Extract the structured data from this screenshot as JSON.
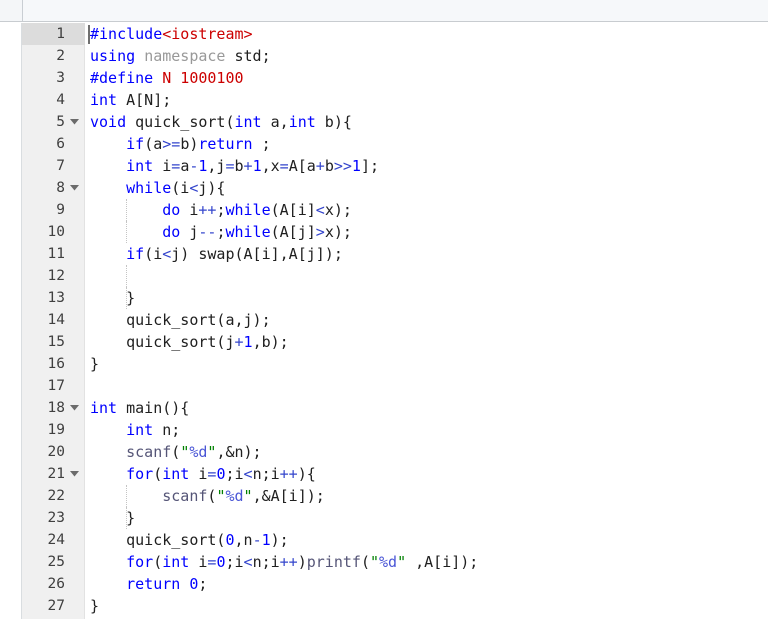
{
  "window": {
    "title": "",
    "toolbar_label": ""
  },
  "editor": {
    "language": "C++",
    "current_line": 1,
    "total_lines_visible": 27,
    "colors": {
      "background": "#ffffff",
      "gutter_background": "#f0f0f0",
      "current_line_gutter": "#dcdcdc",
      "keyword": "#0000ff",
      "string": "#008000",
      "macro": "#cc0000",
      "namespace_gray": "#999999",
      "operator": "#3344cc",
      "format_spec": "#4a56d6",
      "text": "#202020",
      "toolbar": "#f6f8fa"
    },
    "lines": [
      {
        "n": "1",
        "fold": false,
        "guides": []
      },
      {
        "n": "2",
        "fold": false,
        "guides": []
      },
      {
        "n": "3",
        "fold": false,
        "guides": []
      },
      {
        "n": "4",
        "fold": false,
        "guides": []
      },
      {
        "n": "5",
        "fold": true,
        "guides": []
      },
      {
        "n": "6",
        "fold": false,
        "guides": []
      },
      {
        "n": "7",
        "fold": false,
        "guides": []
      },
      {
        "n": "8",
        "fold": true,
        "guides": []
      },
      {
        "n": "9",
        "fold": false,
        "guides": [
          126
        ]
      },
      {
        "n": "10",
        "fold": false,
        "guides": [
          126
        ]
      },
      {
        "n": "11",
        "fold": false,
        "guides": []
      },
      {
        "n": "12",
        "fold": false,
        "guides": [
          126
        ]
      },
      {
        "n": "13",
        "fold": false,
        "guides": [
          126
        ]
      },
      {
        "n": "14",
        "fold": false,
        "guides": []
      },
      {
        "n": "15",
        "fold": false,
        "guides": []
      },
      {
        "n": "16",
        "fold": false,
        "guides": []
      },
      {
        "n": "17",
        "fold": false,
        "guides": []
      },
      {
        "n": "18",
        "fold": true,
        "guides": []
      },
      {
        "n": "19",
        "fold": false,
        "guides": []
      },
      {
        "n": "20",
        "fold": false,
        "guides": []
      },
      {
        "n": "21",
        "fold": true,
        "guides": []
      },
      {
        "n": "22",
        "fold": false,
        "guides": [
          126
        ]
      },
      {
        "n": "23",
        "fold": false,
        "guides": [
          126
        ]
      },
      {
        "n": "24",
        "fold": false,
        "guides": []
      },
      {
        "n": "25",
        "fold": false,
        "guides": []
      },
      {
        "n": "26",
        "fold": false,
        "guides": []
      },
      {
        "n": "27",
        "fold": false,
        "guides": []
      }
    ],
    "source_text": [
      "#include<iostream>",
      "using namespace std;",
      "#define N 1000100",
      "int A[N];",
      "void quick_sort(int a,int b){",
      "    if(a>=b)return ;",
      "    int i=a-1,j=b+1,x=A[a+b>>1];",
      "    while(i<j){",
      "        do i++;while(A[i]<x);",
      "        do j--;while(A[j]>x);",
      "    if(i<j) swap(A[i],A[j]);",
      "",
      "    }",
      "    quick_sort(a,j);",
      "    quick_sort(j+1,b);",
      "}",
      "",
      "int main(){",
      "    int n;",
      "    scanf(\"%d\",&n);",
      "    for(int i=0;i<n;i++){",
      "        scanf(\"%d\",&A[i]);",
      "    }",
      "    quick_sort(0,n-1);",
      "    for(int i=0;i<n;i++)printf(\"%d \",A[i]);",
      "    return 0;",
      "}"
    ],
    "tokens": [
      [
        {
          "t": "#include",
          "c": "t-pre"
        },
        {
          "t": "<iostream>",
          "c": "t-inc"
        }
      ],
      [
        {
          "t": "using",
          "c": "t-key"
        },
        {
          "t": " ",
          "c": "t-plain"
        },
        {
          "t": "namespace",
          "c": "t-gray"
        },
        {
          "t": " ",
          "c": "t-plain"
        },
        {
          "t": "std;",
          "c": "t-plain"
        }
      ],
      [
        {
          "t": "#define",
          "c": "t-pre"
        },
        {
          "t": " ",
          "c": "t-plain"
        },
        {
          "t": "N 1000100",
          "c": "t-inc"
        }
      ],
      [
        {
          "t": "int",
          "c": "t-key"
        },
        {
          "t": " A[N];",
          "c": "t-plain"
        }
      ],
      [
        {
          "t": "void",
          "c": "t-key"
        },
        {
          "t": " quick_sort(",
          "c": "t-plain"
        },
        {
          "t": "int",
          "c": "t-key"
        },
        {
          "t": " a,",
          "c": "t-plain"
        },
        {
          "t": "int",
          "c": "t-key"
        },
        {
          "t": " b){",
          "c": "t-plain"
        }
      ],
      [
        {
          "t": "    ",
          "c": "t-plain"
        },
        {
          "t": "if",
          "c": "t-key"
        },
        {
          "t": "(a",
          "c": "t-plain"
        },
        {
          "t": ">=",
          "c": "t-op"
        },
        {
          "t": "b)",
          "c": "t-plain"
        },
        {
          "t": "return",
          "c": "t-key"
        },
        {
          "t": " ;",
          "c": "t-plain"
        }
      ],
      [
        {
          "t": "    ",
          "c": "t-plain"
        },
        {
          "t": "int",
          "c": "t-key"
        },
        {
          "t": " i",
          "c": "t-plain"
        },
        {
          "t": "=",
          "c": "t-op"
        },
        {
          "t": "a",
          "c": "t-plain"
        },
        {
          "t": "-",
          "c": "t-op"
        },
        {
          "t": "1",
          "c": "t-num"
        },
        {
          "t": ",j",
          "c": "t-plain"
        },
        {
          "t": "=",
          "c": "t-op"
        },
        {
          "t": "b",
          "c": "t-plain"
        },
        {
          "t": "+",
          "c": "t-op"
        },
        {
          "t": "1",
          "c": "t-num"
        },
        {
          "t": ",x",
          "c": "t-plain"
        },
        {
          "t": "=",
          "c": "t-op"
        },
        {
          "t": "A[a",
          "c": "t-plain"
        },
        {
          "t": "+",
          "c": "t-op"
        },
        {
          "t": "b",
          "c": "t-plain"
        },
        {
          "t": ">>",
          "c": "t-op"
        },
        {
          "t": "1",
          "c": "t-num"
        },
        {
          "t": "];",
          "c": "t-plain"
        }
      ],
      [
        {
          "t": "    ",
          "c": "t-plain"
        },
        {
          "t": "while",
          "c": "t-key"
        },
        {
          "t": "(i",
          "c": "t-plain"
        },
        {
          "t": "<",
          "c": "t-op"
        },
        {
          "t": "j){",
          "c": "t-plain"
        }
      ],
      [
        {
          "t": "        ",
          "c": "t-plain"
        },
        {
          "t": "do",
          "c": "t-key"
        },
        {
          "t": " i",
          "c": "t-plain"
        },
        {
          "t": "++",
          "c": "t-op"
        },
        {
          "t": ";",
          "c": "t-plain"
        },
        {
          "t": "while",
          "c": "t-key"
        },
        {
          "t": "(A[i]",
          "c": "t-plain"
        },
        {
          "t": "<",
          "c": "t-op"
        },
        {
          "t": "x);",
          "c": "t-plain"
        }
      ],
      [
        {
          "t": "        ",
          "c": "t-plain"
        },
        {
          "t": "do",
          "c": "t-key"
        },
        {
          "t": " j",
          "c": "t-plain"
        },
        {
          "t": "--",
          "c": "t-op"
        },
        {
          "t": ";",
          "c": "t-plain"
        },
        {
          "t": "while",
          "c": "t-key"
        },
        {
          "t": "(A[j]",
          "c": "t-plain"
        },
        {
          "t": ">",
          "c": "t-op"
        },
        {
          "t": "x);",
          "c": "t-plain"
        }
      ],
      [
        {
          "t": "    ",
          "c": "t-plain"
        },
        {
          "t": "if",
          "c": "t-key"
        },
        {
          "t": "(i",
          "c": "t-plain"
        },
        {
          "t": "<",
          "c": "t-op"
        },
        {
          "t": "j) swap(A[i],A[j]);",
          "c": "t-plain"
        }
      ],
      [
        {
          "t": "",
          "c": "t-plain"
        }
      ],
      [
        {
          "t": "    }",
          "c": "t-plain"
        }
      ],
      [
        {
          "t": "    quick_sort(a,j);",
          "c": "t-plain"
        }
      ],
      [
        {
          "t": "    quick_sort(j",
          "c": "t-plain"
        },
        {
          "t": "+",
          "c": "t-op"
        },
        {
          "t": "1",
          "c": "t-num"
        },
        {
          "t": ",b);",
          "c": "t-plain"
        }
      ],
      [
        {
          "t": "}",
          "c": "t-plain"
        }
      ],
      [
        {
          "t": "",
          "c": "t-plain"
        }
      ],
      [
        {
          "t": "int",
          "c": "t-key"
        },
        {
          "t": " main(){",
          "c": "t-plain"
        }
      ],
      [
        {
          "t": "    ",
          "c": "t-plain"
        },
        {
          "t": "int",
          "c": "t-key"
        },
        {
          "t": " n;",
          "c": "t-plain"
        }
      ],
      [
        {
          "t": "    ",
          "c": "t-plain"
        },
        {
          "t": "scanf",
          "c": "t-lib"
        },
        {
          "t": "(",
          "c": "t-plain"
        },
        {
          "t": "\"",
          "c": "t-str"
        },
        {
          "t": "%d",
          "c": "t-fmt"
        },
        {
          "t": "\"",
          "c": "t-str"
        },
        {
          "t": ",&n);",
          "c": "t-plain"
        }
      ],
      [
        {
          "t": "    ",
          "c": "t-plain"
        },
        {
          "t": "for",
          "c": "t-key"
        },
        {
          "t": "(",
          "c": "t-plain"
        },
        {
          "t": "int",
          "c": "t-key"
        },
        {
          "t": " i",
          "c": "t-plain"
        },
        {
          "t": "=",
          "c": "t-op"
        },
        {
          "t": "0",
          "c": "t-num"
        },
        {
          "t": ";i",
          "c": "t-plain"
        },
        {
          "t": "<",
          "c": "t-op"
        },
        {
          "t": "n;i",
          "c": "t-plain"
        },
        {
          "t": "++",
          "c": "t-op"
        },
        {
          "t": "){",
          "c": "t-plain"
        }
      ],
      [
        {
          "t": "        ",
          "c": "t-plain"
        },
        {
          "t": "scanf",
          "c": "t-lib"
        },
        {
          "t": "(",
          "c": "t-plain"
        },
        {
          "t": "\"",
          "c": "t-str"
        },
        {
          "t": "%d",
          "c": "t-fmt"
        },
        {
          "t": "\"",
          "c": "t-str"
        },
        {
          "t": ",&A[i]);",
          "c": "t-plain"
        }
      ],
      [
        {
          "t": "    }",
          "c": "t-plain"
        }
      ],
      [
        {
          "t": "    quick_sort(",
          "c": "t-plain"
        },
        {
          "t": "0",
          "c": "t-num"
        },
        {
          "t": ",n",
          "c": "t-plain"
        },
        {
          "t": "-",
          "c": "t-op"
        },
        {
          "t": "1",
          "c": "t-num"
        },
        {
          "t": ");",
          "c": "t-plain"
        }
      ],
      [
        {
          "t": "    ",
          "c": "t-plain"
        },
        {
          "t": "for",
          "c": "t-key"
        },
        {
          "t": "(",
          "c": "t-plain"
        },
        {
          "t": "int",
          "c": "t-key"
        },
        {
          "t": " i",
          "c": "t-plain"
        },
        {
          "t": "=",
          "c": "t-op"
        },
        {
          "t": "0",
          "c": "t-num"
        },
        {
          "t": ";i",
          "c": "t-plain"
        },
        {
          "t": "<",
          "c": "t-op"
        },
        {
          "t": "n;i",
          "c": "t-plain"
        },
        {
          "t": "++",
          "c": "t-op"
        },
        {
          "t": ")",
          "c": "t-plain"
        },
        {
          "t": "printf",
          "c": "t-lib"
        },
        {
          "t": "(",
          "c": "t-plain"
        },
        {
          "t": "\"",
          "c": "t-str"
        },
        {
          "t": "%d",
          "c": "t-fmt"
        },
        {
          "t": "\" ",
          "c": "t-str"
        },
        {
          "t": ",A[i]);",
          "c": "t-plain"
        }
      ],
      [
        {
          "t": "    ",
          "c": "t-plain"
        },
        {
          "t": "return",
          "c": "t-key"
        },
        {
          "t": " ",
          "c": "t-plain"
        },
        {
          "t": "0",
          "c": "t-num"
        },
        {
          "t": ";",
          "c": "t-plain"
        }
      ],
      [
        {
          "t": "}",
          "c": "t-plain"
        }
      ]
    ]
  }
}
